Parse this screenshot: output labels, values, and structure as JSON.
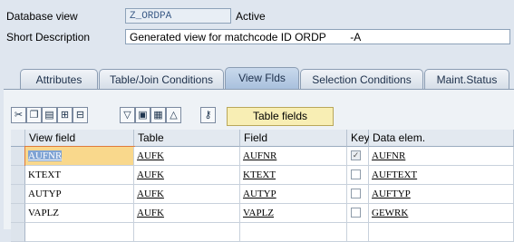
{
  "header": {
    "db_view_label": "Database view",
    "db_view_value": "Z_ORDPA",
    "status": "Active",
    "short_desc_label": "Short Description",
    "short_desc_value": "Generated view for matchcode ID ORDP        -A"
  },
  "tabs": [
    "Attributes",
    "Table/Join Conditions",
    "View Flds",
    "Selection Conditions",
    "Maint.Status"
  ],
  "active_tab": "View Flds",
  "toolbar": {
    "icons": [
      "cut-icon",
      "copy-icon",
      "paste-icon",
      "insert-row-icon",
      "delete-row-icon",
      "select-all-icon",
      "select-block-icon",
      "deselect-all-icon",
      "sort-icon",
      "key-icon"
    ],
    "table_fields_label": "Table fields"
  },
  "grid": {
    "columns": [
      "View field",
      "Table",
      "Field",
      "Key",
      "Data elem."
    ],
    "rows": [
      {
        "view_field": "AUFNR",
        "table": "AUFK",
        "field": "AUFNR",
        "key": true,
        "data_elem": "AUFNR"
      },
      {
        "view_field": "KTEXT",
        "table": "AUFK",
        "field": "KTEXT",
        "key": false,
        "data_elem": "AUFTEXT"
      },
      {
        "view_field": "AUTYP",
        "table": "AUFK",
        "field": "AUTYP",
        "key": false,
        "data_elem": "AUFTYP"
      },
      {
        "view_field": "VAPLZ",
        "table": "AUFK",
        "field": "VAPLZ",
        "key": false,
        "data_elem": "GEWRK"
      }
    ]
  }
}
